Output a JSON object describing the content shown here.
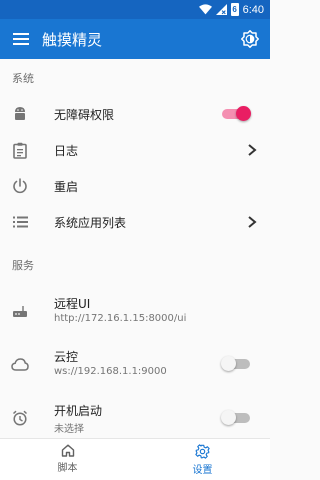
{
  "status_bar": {
    "time": "6:40",
    "battery_level": "6"
  },
  "app_bar": {
    "title": "触摸精灵",
    "menu_icon": "menu-icon",
    "action_icon": "brightness-auto-icon"
  },
  "sections": [
    {
      "header": "系统",
      "rows": [
        {
          "label": "无障碍权限",
          "icon": "android-icon",
          "control": "switch",
          "enabled": true
        },
        {
          "label": "日志",
          "icon": "clipboard-list-icon",
          "control": "chevron"
        },
        {
          "label": "重启",
          "icon": "power-icon",
          "control": "none"
        },
        {
          "label": "系统应用列表",
          "icon": "list-icon",
          "control": "chevron"
        }
      ]
    },
    {
      "header": "服务",
      "rows": [
        {
          "label": "远程UI",
          "subtitle": "http://172.16.1.15:8000/ui",
          "icon": "router-icon",
          "control": "none"
        },
        {
          "label": "云控",
          "subtitle": "ws://192.168.1.1:9000",
          "icon": "cloud-icon",
          "control": "switch",
          "enabled": false
        },
        {
          "label": "开机启动",
          "subtitle": "未选择",
          "icon": "alarm-icon",
          "control": "switch",
          "enabled": false
        }
      ]
    }
  ],
  "bottom_nav": [
    {
      "label": "脚本",
      "icon": "home-icon",
      "active": false
    },
    {
      "label": "设置",
      "icon": "settings-icon",
      "active": true
    }
  ],
  "colors": {
    "primary": "#1976d2",
    "status_bar": "#1565c0",
    "accent": "#e91e63"
  }
}
